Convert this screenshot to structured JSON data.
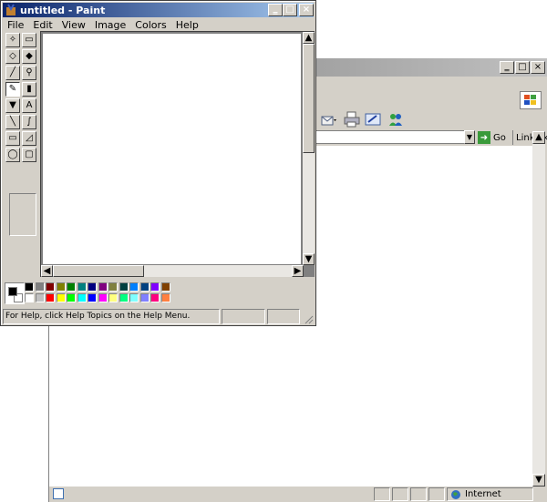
{
  "paint": {
    "title": "untitled - Paint",
    "menu": [
      "File",
      "Edit",
      "View",
      "Image",
      "Colors",
      "Help"
    ],
    "status_text": "For Help, click Help Topics on the Help Menu.",
    "tools": [
      "free-form-select",
      "select",
      "eraser",
      "fill-with-color",
      "pick-color",
      "magnifier",
      "pencil",
      "brush",
      "airbrush",
      "text",
      "line",
      "curve",
      "rectangle",
      "polygon",
      "ellipse",
      "rounded-rectangle"
    ],
    "tool_glyphs": [
      "✧",
      "▭",
      "◇",
      "◆",
      "╱",
      "⚲",
      "✎",
      "▮",
      "▼",
      "A",
      "╲",
      "∫",
      "▭",
      "◿",
      "◯",
      "▢"
    ],
    "active_tool": "pencil",
    "palette_top": [
      "#000000",
      "#808080",
      "#800000",
      "#808000",
      "#008000",
      "#008080",
      "#000080",
      "#800080",
      "#808040",
      "#004040",
      "#0080ff",
      "#004080",
      "#8000ff",
      "#804000"
    ],
    "palette_bottom": [
      "#ffffff",
      "#c0c0c0",
      "#ff0000",
      "#ffff00",
      "#00ff00",
      "#00ffff",
      "#0000ff",
      "#ff00ff",
      "#ffff80",
      "#00ff80",
      "#80ffff",
      "#8080ff",
      "#ff0080",
      "#ff8040"
    ],
    "foreground_color": "#000000",
    "background_color": "#ffffff"
  },
  "ie": {
    "go_label": "Go",
    "links_label": "Links",
    "links_chevron": "»",
    "status_zone": "Internet"
  }
}
